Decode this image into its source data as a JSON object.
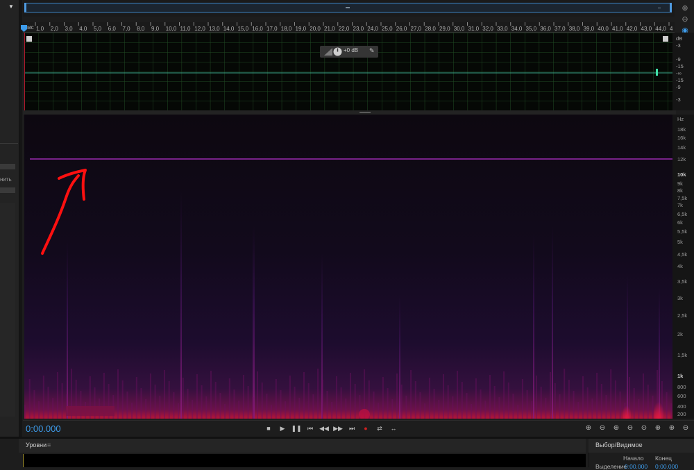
{
  "left_panel": {
    "text_1": "нить",
    "dropdown_icon": "chevron-down-icon"
  },
  "ruler": {
    "unit": "чмс",
    "ticks": [
      "1,0",
      "2,0",
      "3,0",
      "4,0",
      "5,0",
      "6,0",
      "7,0",
      "8,0",
      "9,0",
      "10,0",
      "11,0",
      "12,0",
      "13,0",
      "14,0",
      "15,0",
      "16,0",
      "17,0",
      "18,0",
      "19,0",
      "20,0",
      "21,0",
      "22,0",
      "23,0",
      "24,0",
      "25,0",
      "26,0",
      "27,0",
      "28,0",
      "29,0",
      "30,0",
      "31,0",
      "32,0",
      "33,0",
      "34,0",
      "35,0",
      "36,0",
      "37,0",
      "38,0",
      "39,0",
      "40,0",
      "41,0",
      "42,0",
      "43,0",
      "44,0",
      "4"
    ]
  },
  "waveform": {
    "hud_value": "+0 dB",
    "db_labels": [
      "dB",
      "-3",
      "-9",
      "-15",
      "-∞",
      "-15",
      "-9",
      "-3"
    ]
  },
  "spectrogram": {
    "hz_labels": [
      "Hz",
      "18k",
      "16k",
      "14k",
      "12k",
      "10k",
      "9k",
      "8k",
      "7,5k",
      "7k",
      "6,5k",
      "6k",
      "5,5k",
      "5k",
      "4,5k",
      "4k",
      "3,5k",
      "3k",
      "2,5k",
      "2k",
      "1,5k",
      "1k",
      "800",
      "600",
      "400",
      "200"
    ]
  },
  "transport": {
    "time": "0:00.000"
  },
  "levels_panel": {
    "title": "Уровни",
    "menu": "≡"
  },
  "selection_panel": {
    "title": "Выбор/Видимое",
    "menu": "≡",
    "col_start": "Начало",
    "col_end": "Конец",
    "row_label": "Выделение",
    "row_start": "0:00.000",
    "row_end": "0:00.000"
  },
  "colors": {
    "accent": "#3d9bea",
    "spectro_low": "#2a0a3a",
    "spectro_hot": "#d01040",
    "annotation": "#ff1010",
    "tone_line": "#9a2ab0"
  }
}
